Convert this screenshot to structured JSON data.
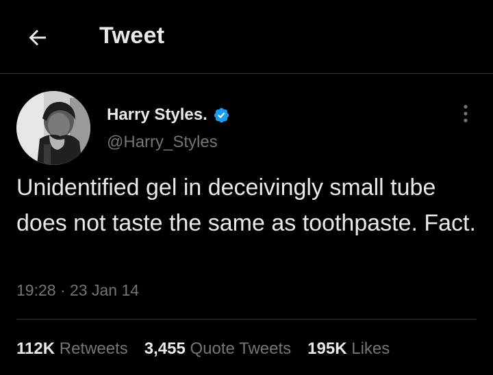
{
  "header": {
    "title": "Tweet",
    "back_icon": "arrow-left-icon"
  },
  "author": {
    "display_name": "Harry Styles.",
    "handle": "@Harry_Styles",
    "verified": true,
    "verified_color": "#1d9bf0"
  },
  "tweet": {
    "text": "Unidentified gel in deceivingly small tube does not taste the same as toothpaste. Fact.",
    "time": "19:28",
    "separator": "·",
    "date": "23 Jan 14"
  },
  "stats": {
    "retweets": {
      "value": "112K",
      "label": "Retweets"
    },
    "quotes": {
      "value": "3,455",
      "label": "Quote Tweets"
    },
    "likes": {
      "value": "195K",
      "label": "Likes"
    }
  },
  "colors": {
    "background": "#000000",
    "text": "#e7e9ea",
    "secondary": "#71767b",
    "divider": "#2f3336"
  }
}
